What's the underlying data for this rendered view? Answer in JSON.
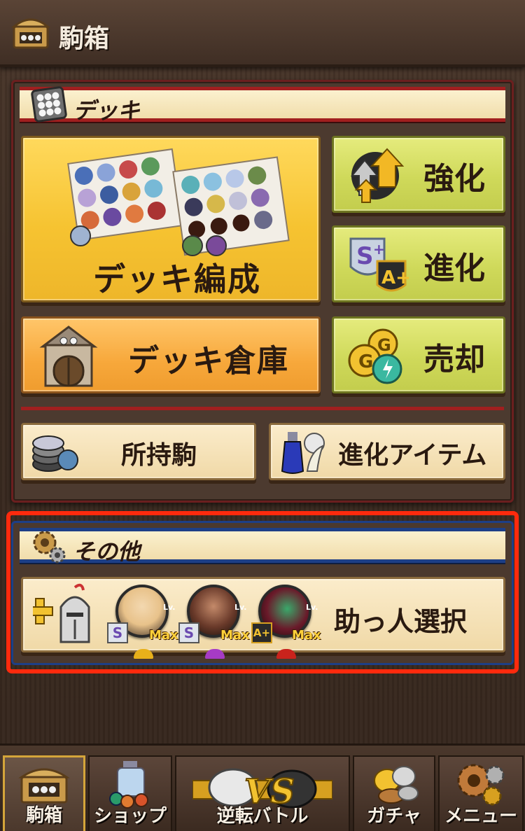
{
  "header": {
    "title": "駒箱"
  },
  "deck_section": {
    "ribbon_label": "デッキ",
    "deck_edit_label": "デッキ編成",
    "enhance_label": "強化",
    "evolve_label": "進化",
    "warehouse_label": "デッキ倉庫",
    "sell_label": "売却",
    "owned_pieces_label": "所持駒",
    "evolve_items_label": "進化アイテム"
  },
  "other_section": {
    "ribbon_label": "その他",
    "helper_label": "助っ人選択",
    "helpers": [
      {
        "rank": "S",
        "level": "Max",
        "lv": "Lv.",
        "color": "#f1c232",
        "pip_color": "#e8b01a"
      },
      {
        "rank": "S",
        "level": "Max",
        "lv": "Lv.",
        "color": "#b04fc4",
        "pip_color": "#a63bc5"
      },
      {
        "rank": "A+",
        "level": "Max",
        "lv": "Lv.",
        "color": "#c8342a",
        "pip_color": "#c9231c"
      }
    ]
  },
  "nav": {
    "items": [
      {
        "label": "駒箱",
        "icon": "chest-icon",
        "active": true
      },
      {
        "label": "ショップ",
        "icon": "shop-bottle-icon",
        "active": false
      },
      {
        "label": "逆転バトル",
        "icon": "vs-battle-icon",
        "active": false
      },
      {
        "label": "ガチャ",
        "icon": "coins-icon",
        "active": false
      },
      {
        "label": "メニュー",
        "icon": "gears-icon",
        "active": false
      }
    ]
  },
  "colors": {
    "deck_accent": "#a11f1f",
    "other_accent": "#1d3f87",
    "highlight_box": "#ff2a0d"
  }
}
